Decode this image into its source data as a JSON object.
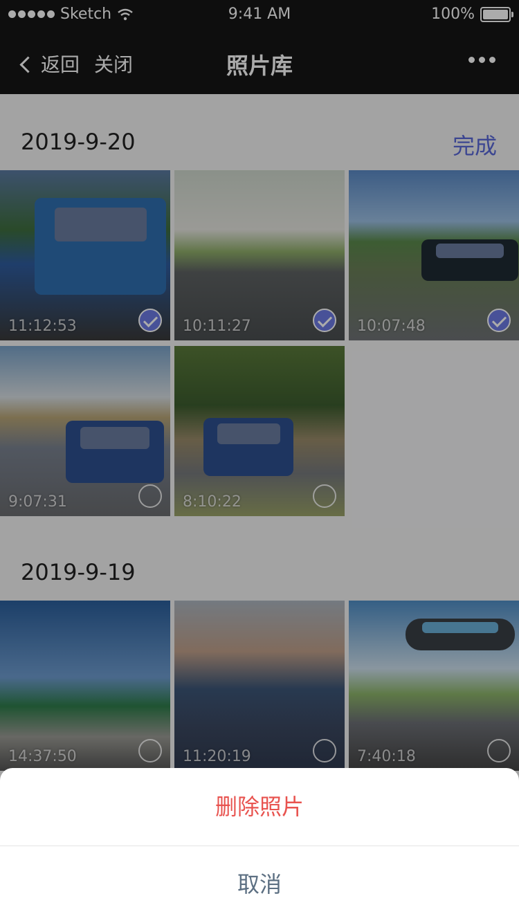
{
  "status": {
    "carrier": "Sketch",
    "time": "9:41 AM",
    "battery": "100%"
  },
  "nav": {
    "back": "返回",
    "close": "关闭",
    "title": "照片库"
  },
  "sections": [
    {
      "date": "2019-9-20",
      "done": "完成",
      "photos": [
        {
          "time": "11:12:53",
          "checked": true
        },
        {
          "time": "10:11:27",
          "checked": true
        },
        {
          "time": "10:07:48",
          "checked": true
        },
        {
          "time": "9:07:31",
          "checked": false
        },
        {
          "time": "8:10:22",
          "checked": false
        }
      ]
    },
    {
      "date": "2019-9-19",
      "photos": [
        {
          "time": "14:37:50",
          "checked": false
        },
        {
          "time": "11:20:19",
          "checked": false
        },
        {
          "time": "7:40:18",
          "checked": false
        }
      ]
    }
  ],
  "sheet": {
    "delete": "删除照片",
    "cancel": "取消"
  },
  "colors": {
    "accent": "#5a69d8",
    "danger": "#e8534f",
    "navbar": "#151515"
  }
}
